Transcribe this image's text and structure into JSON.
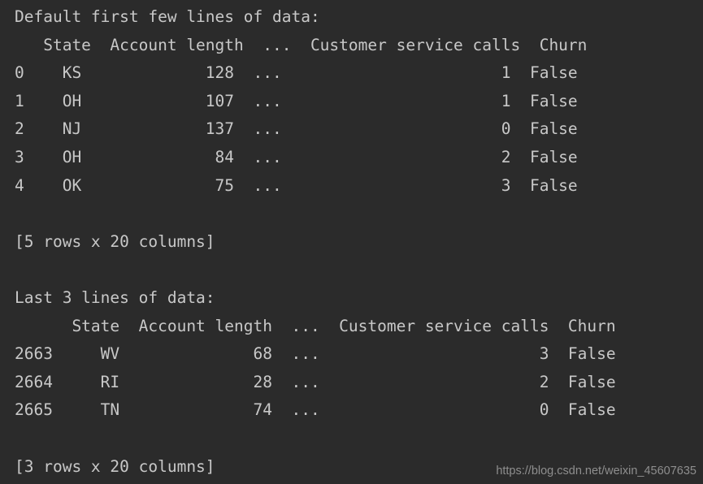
{
  "app": {
    "type": "console-output",
    "background_color": "#2b2b2b",
    "text_color": "#c8c8c8",
    "watermark_color": "#8e8e8e"
  },
  "watermark": {
    "text": "https://blog.csdn.net/weixin_45607635"
  },
  "output": {
    "lines": [
      "Default first few lines of data:",
      "   State  Account length  ...  Customer service calls  Churn",
      "0    KS             128  ...                       1  False",
      "1    OH             107  ...                       1  False",
      "2    NJ             137  ...                       0  False",
      "3    OH              84  ...                       2  False",
      "4    OK              75  ...                       3  False",
      "",
      "[5 rows x 20 columns]",
      "",
      "Last 3 lines of data:",
      "      State  Account length  ...  Customer service calls  Churn",
      "2663     WV              68  ...                       3  False",
      "2664     RI              28  ...                       2  False",
      "2665     TN              74  ...                       0  False",
      "",
      "[3 rows x 20 columns]"
    ]
  },
  "sections": {
    "first": {
      "caption": "Default first few lines of data:",
      "summary": "[5 rows x 20 columns]",
      "columns": [
        "",
        "State",
        "Account length",
        "...",
        "Customer service calls",
        "Churn"
      ],
      "rows": [
        {
          "index": "0",
          "state": "KS",
          "account_length": "128",
          "ellipsis": "...",
          "customer_service_calls": "1",
          "churn": "False"
        },
        {
          "index": "1",
          "state": "OH",
          "account_length": "107",
          "ellipsis": "...",
          "customer_service_calls": "1",
          "churn": "False"
        },
        {
          "index": "2",
          "state": "NJ",
          "account_length": "137",
          "ellipsis": "...",
          "customer_service_calls": "0",
          "churn": "False"
        },
        {
          "index": "3",
          "state": "OH",
          "account_length": "84",
          "ellipsis": "...",
          "customer_service_calls": "2",
          "churn": "False"
        },
        {
          "index": "4",
          "state": "OK",
          "account_length": "75",
          "ellipsis": "...",
          "customer_service_calls": "3",
          "churn": "False"
        }
      ],
      "row_count": "5",
      "column_count": "20"
    },
    "last": {
      "caption": "Last 3 lines of data:",
      "summary": "[3 rows x 20 columns]",
      "columns": [
        "",
        "State",
        "Account length",
        "...",
        "Customer service calls",
        "Churn"
      ],
      "rows": [
        {
          "index": "2663",
          "state": "WV",
          "account_length": "68",
          "ellipsis": "...",
          "customer_service_calls": "3",
          "churn": "False"
        },
        {
          "index": "2664",
          "state": "RI",
          "account_length": "28",
          "ellipsis": "...",
          "customer_service_calls": "2",
          "churn": "False"
        },
        {
          "index": "2665",
          "state": "TN",
          "account_length": "74",
          "ellipsis": "...",
          "customer_service_calls": "0",
          "churn": "False"
        }
      ],
      "row_count": "3",
      "column_count": "20"
    }
  }
}
